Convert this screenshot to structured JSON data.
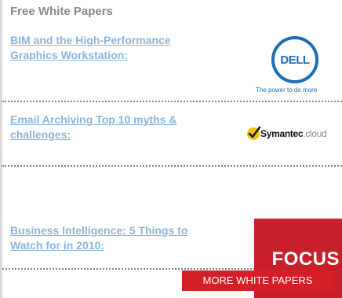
{
  "header": {
    "title": "Free White Papers"
  },
  "papers": [
    {
      "line1": "BIM and the High-Performance",
      "line2": "Graphics Workstation:"
    },
    {
      "line1": "Email Archiving Top 10 myths &",
      "line2": "challenges:"
    },
    {
      "line1": "Business Intelligence: 5 Things to",
      "line2": "Watch for in 2010:"
    }
  ],
  "logos": {
    "dell": {
      "name": "DELL",
      "tagline": "The power to do more"
    },
    "symantec": {
      "name": "Symantec",
      "suffix": ".cloud"
    },
    "focus": {
      "name": "FOCUS",
      "cta": "MORE WHITE PAPERS"
    }
  },
  "colors": {
    "link": "#8cb4d8",
    "header": "#8a8a8a",
    "dell_blue": "#1d6fb8",
    "focus_red": "#c8202a",
    "symantec_yellow": "#f5c400"
  }
}
